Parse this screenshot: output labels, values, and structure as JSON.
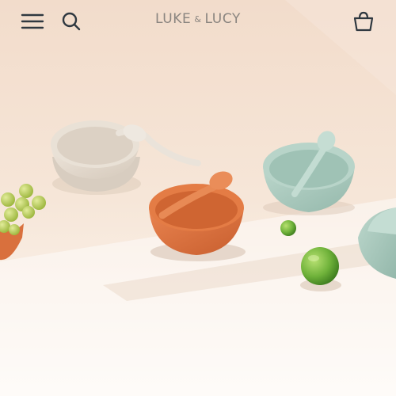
{
  "header": {
    "brand_word_1": "LUKE",
    "brand_ampersand": "&",
    "brand_word_2": "LUCY",
    "icons": {
      "menu": "hamburger-menu-icon",
      "search": "search-icon",
      "cart": "shopping-basket-icon"
    }
  },
  "colors": {
    "background_top": "#f3dfcf",
    "background_bottom": "#fdf8f3",
    "logo_text": "#8a8580",
    "icon_stroke": "#2f3840",
    "bowl_beige": "#e5dcd0",
    "bowl_terracotta": "#d9703d",
    "bowl_sage": "#a9c9be",
    "lime": "#6fb23a",
    "grape": "#b9cd5a"
  }
}
